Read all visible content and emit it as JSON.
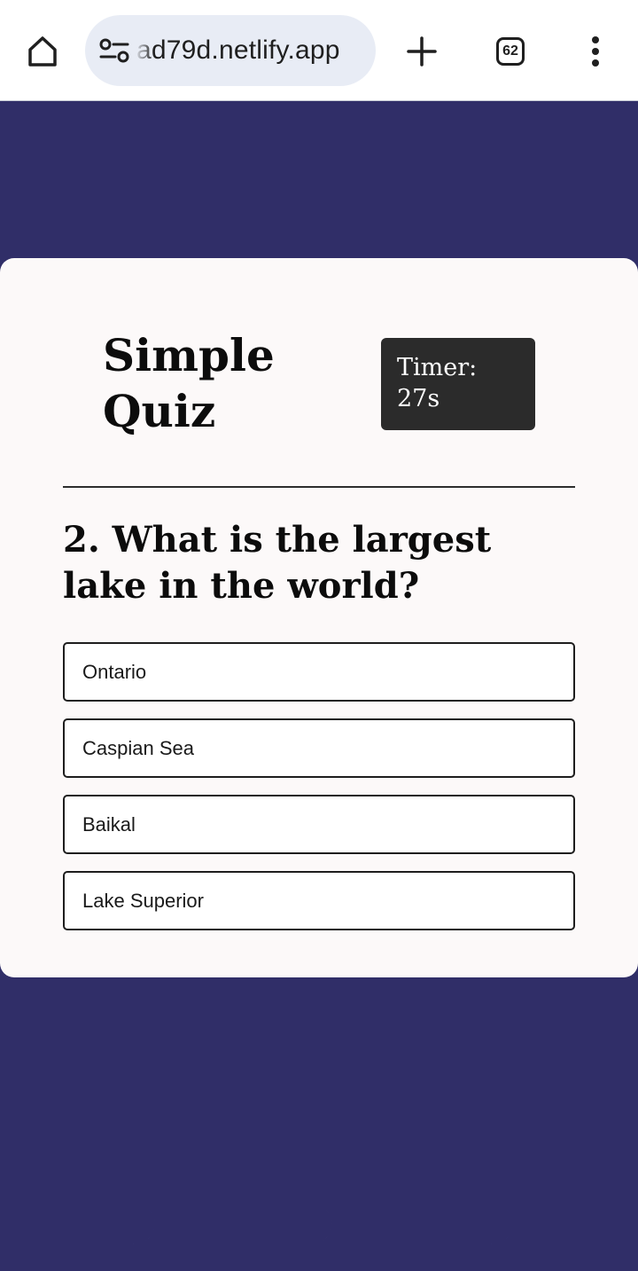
{
  "browser": {
    "url": "ad79d.netlify.app",
    "tab_count": "62",
    "icons": {
      "home": "home-icon",
      "site_info": "site-info-icon",
      "new_tab": "plus-icon",
      "tabs": "tab-switcher-icon",
      "menu": "more-vertical-icon"
    }
  },
  "quiz": {
    "title": "Simple Quiz",
    "timer_label": "Timer: 27s",
    "question": "2. What is the largest lake in the world?",
    "options": [
      "Ontario",
      "Caspian Sea",
      "Baikal",
      "Lake Superior"
    ]
  },
  "colors": {
    "page_background": "#302e68",
    "card_background": "#fcf9f9",
    "timer_background": "#2b2b2b",
    "moon_colors": [
      "#6f93d6",
      "#b7b2cc",
      "#5f86dc"
    ]
  },
  "decorations": {
    "moons": [
      "crescent-moon-icon",
      "crescent-moon-icon",
      "crescent-moon-icon"
    ]
  }
}
